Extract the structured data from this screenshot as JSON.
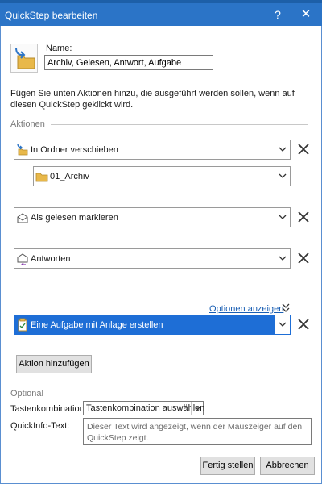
{
  "window": {
    "title": "QuickStep bearbeiten",
    "help_label": "?",
    "close_label": "✕"
  },
  "name": {
    "label": "Name:",
    "value": "Archiv, Gelesen, Antwort, Aufgabe"
  },
  "intro_text": "Fügen Sie unten Aktionen hinzu, die ausgeführt werden sollen, wenn auf diesen QuickStep geklickt wird.",
  "actions_section": {
    "label": "Aktionen"
  },
  "actions": [
    {
      "label": "In Ordner verschieben",
      "icon": "move-to-folder-icon"
    },
    {
      "label": "01_Archiv",
      "icon": "folder-icon"
    },
    {
      "label": "Als gelesen markieren",
      "icon": "envelope-open-icon"
    },
    {
      "label": "Antworten",
      "icon": "reply-icon"
    },
    {
      "label": "Eine Aufgabe mit Anlage erstellen",
      "icon": "task-icon",
      "selected": true
    }
  ],
  "options_link": "Optionen anzeigen",
  "add_action_button": "Aktion hinzufügen",
  "optional_section": {
    "label": "Optional",
    "shortcut_label": "Tastenkombination:",
    "shortcut_value": "Tastenkombination auswählen",
    "tooltip_label": "QuickInfo-Text:",
    "tooltip_value": "Dieser Text wird angezeigt, wenn der Mauszeiger auf den QuickStep zeigt."
  },
  "footer": {
    "finish_button": "Fertig stellen",
    "cancel_button": "Abbrechen"
  },
  "colors": {
    "titlebar": "#2b74c7",
    "selection": "#1e6ed6",
    "link": "#1a5fb4",
    "folder": "#e8b84a"
  }
}
